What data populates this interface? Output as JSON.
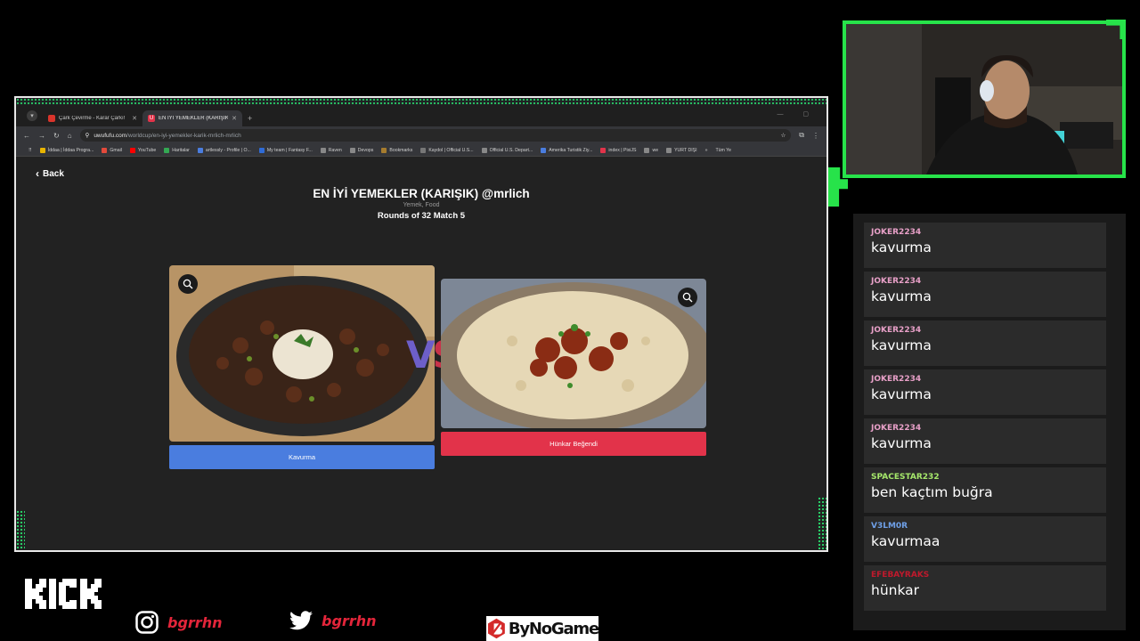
{
  "browser": {
    "tabs": [
      {
        "title": "Çark Çevirme - Karar Çarkı!",
        "active": false
      },
      {
        "title": "EN İYİ YEMEKLER (KARIŞIK) @",
        "active": true
      }
    ],
    "url_domain": "uwufufu.com",
    "url_path": "/worldcup/en-iyi-yemekler-karik-mrlich-mrlich",
    "bookmarks": [
      "İddaa | İddaa Progra...",
      "Gmail",
      "YouTube",
      "Haritalar",
      "artlessly - Profile | O...",
      "My team | Fantasy F...",
      "Raven",
      "Devops",
      "Bookmarks",
      "Kaydol | Official U.S...",
      "Official U.S. Depart...",
      "Amerika Turistik Ziy...",
      "index | PixiJS",
      "we",
      "YURT DIŞI"
    ],
    "bookmarks_more": "»",
    "bookmarks_all": "Tüm Ye"
  },
  "page": {
    "back_label": "Back",
    "title": "EN İYİ YEMEKLER (KARIŞIK) @mrlich",
    "categories": "Yemek, Food",
    "rounds": "Rounds of 32 Match 5",
    "vs": "VS",
    "left_choice": {
      "label": "Kavurma",
      "color": "#4a7ddf"
    },
    "right_choice": {
      "label": "Hünkar Beğendi",
      "color": "#e2334a"
    }
  },
  "chat": [
    {
      "user": "JOKER2234",
      "color": "#e8a0c8",
      "text": "kavurma"
    },
    {
      "user": "JOKER2234",
      "color": "#e8a0c8",
      "text": "kavurma"
    },
    {
      "user": "JOKER2234",
      "color": "#e8a0c8",
      "text": "kavurma"
    },
    {
      "user": "JOKER2234",
      "color": "#e8a0c8",
      "text": "kavurma"
    },
    {
      "user": "JOKER2234",
      "color": "#e8a0c8",
      "text": "kavurma"
    },
    {
      "user": "SPACESTAR232",
      "color": "#a6e86b",
      "text": "ben kaçtım buğra"
    },
    {
      "user": "V3LM0R",
      "color": "#6fa0e8",
      "text": "kavurmaa"
    },
    {
      "user": "EFEBAYRAKS",
      "color": "#c0192c",
      "text": "hünkar"
    }
  ],
  "branding": {
    "instagram": "bgrrhn",
    "twitter": "bgrrhn",
    "sponsor": "ByNoGame",
    "accent": "#27e34a"
  }
}
